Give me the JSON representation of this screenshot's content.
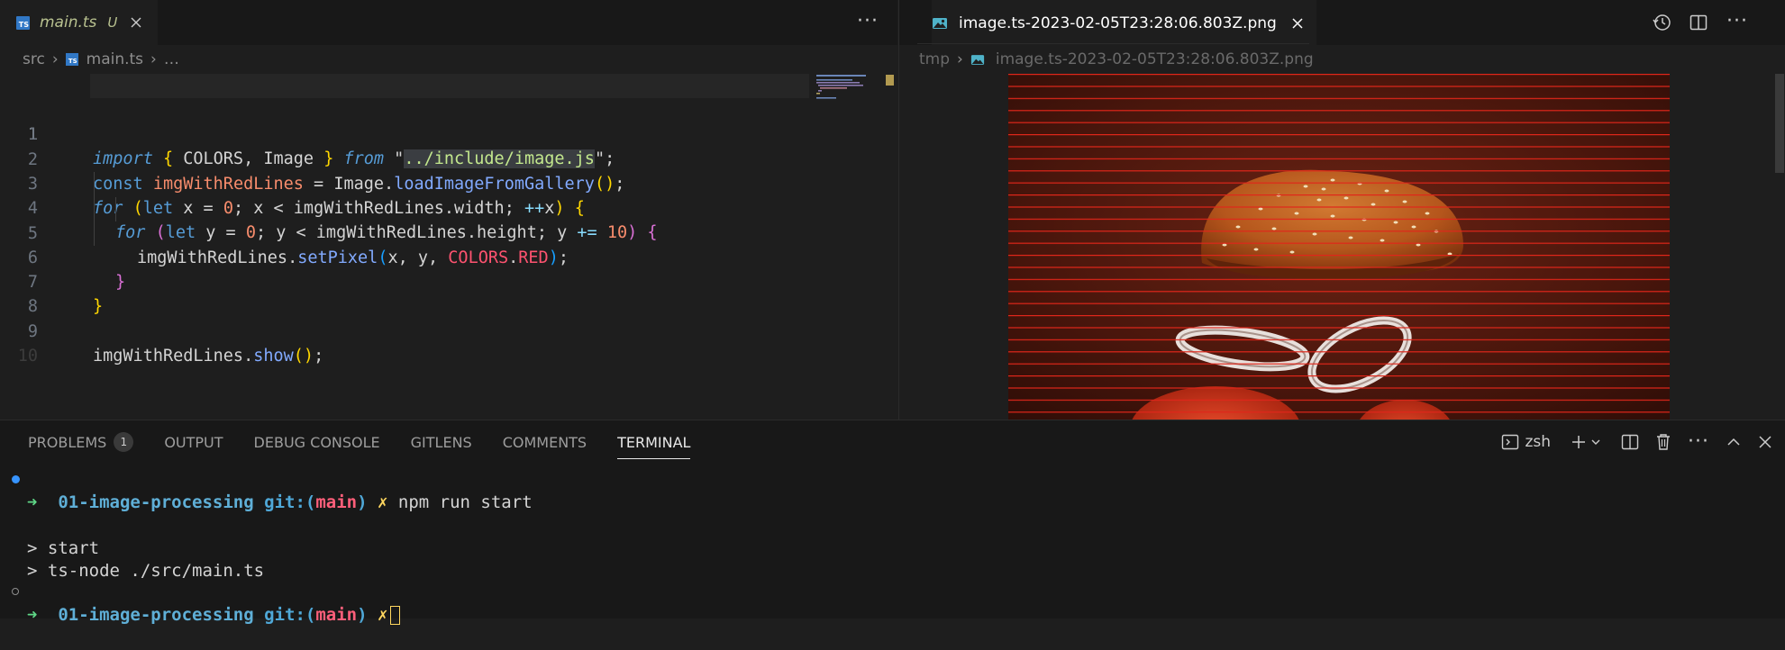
{
  "left_editor": {
    "tab": {
      "label": "main.ts",
      "status": "U",
      "close": "✕"
    },
    "more": "···",
    "breadcrumb": {
      "folder": "src",
      "sep1": "›",
      "file": "main.ts",
      "sep2": "›",
      "symbol": "…"
    },
    "line_numbers": [
      "1",
      "1",
      "2",
      "3",
      "4",
      "5",
      "6",
      "7",
      "8",
      "9",
      "10"
    ],
    "code": {
      "l1": {
        "import": "import",
        "brace_open": "{",
        "names": " COLORS, Image ",
        "brace_close": "}",
        "from": "from",
        "q1": "\"",
        "path": "../include/image.js",
        "q2": "\"",
        "semi": ";"
      },
      "l2": {
        "const": "const",
        "var": "imgWithRedLines",
        "eq": " = ",
        "obj": "Image",
        "dot": ".",
        "fn": "loadImageFromGallery",
        "parens": "()",
        "semi": ";"
      },
      "l3": {
        "for": "for",
        "p_open": "(",
        "let": "let",
        "x": " x = ",
        "zero": "0",
        "cond": "; x < imgWithRedLines.width; ",
        "inc": "++",
        "x2": "x",
        "p_close": ")",
        "brace": "{"
      },
      "l4": {
        "for": "for",
        "p_open": "(",
        "let": "let",
        "y": " y = ",
        "zero": "0",
        "cond": "; y < imgWithRedLines.height; y ",
        "inc": "+=",
        "ten": "10",
        "p_close": ")",
        "brace": "{"
      },
      "l5": {
        "obj": "imgWithRedLines",
        "dot": ".",
        "fn": "setPixel",
        "p_open": "(",
        "args": "x, y, ",
        "colors": "COLORS",
        "dot2": ".",
        "red": "RED",
        "p_close": ")",
        "semi": ";"
      },
      "l6": {
        "brace": "}"
      },
      "l7": {
        "brace": "}"
      },
      "l9": {
        "obj": "imgWithRedLines",
        "dot": ".",
        "fn": "show",
        "parens": "()",
        "semi": ";"
      }
    }
  },
  "right_editor": {
    "tab": {
      "label": "image.ts-2023-02-05T23:28:06.803Z.png",
      "close": "✕"
    },
    "breadcrumb": {
      "folder": "tmp",
      "sep": "›",
      "file": "image.ts-2023-02-05T23:28:06.803Z.png"
    },
    "actions": [
      "history-icon",
      "split-editor-icon",
      "more-actions-icon"
    ],
    "more": "···",
    "image": {
      "subject": "burger bun, onion rings and tomato slices with horizontal red lines every 10 px",
      "line_color": "#e0261a"
    }
  },
  "panel": {
    "tabs": [
      {
        "label": "PROBLEMS",
        "badge": "1"
      },
      {
        "label": "OUTPUT"
      },
      {
        "label": "DEBUG CONSOLE"
      },
      {
        "label": "GITLENS"
      },
      {
        "label": "COMMENTS"
      },
      {
        "label": "TERMINAL",
        "active": true
      }
    ],
    "shell": "zsh",
    "more": "···"
  },
  "terminal": {
    "prompt": {
      "arrow": "➜",
      "dir": "01-image-processing",
      "git": "git:(",
      "branch": "main",
      "git_close": ")",
      "dirty": "✗"
    },
    "command": "npm run start",
    "output": [
      "> start",
      "> ts-node ./src/main.ts"
    ]
  },
  "colors": {
    "accent": "#3794ff",
    "ts_blue": "#3178c6",
    "bg": "#1e1e1e",
    "panel_bg": "#181818"
  }
}
